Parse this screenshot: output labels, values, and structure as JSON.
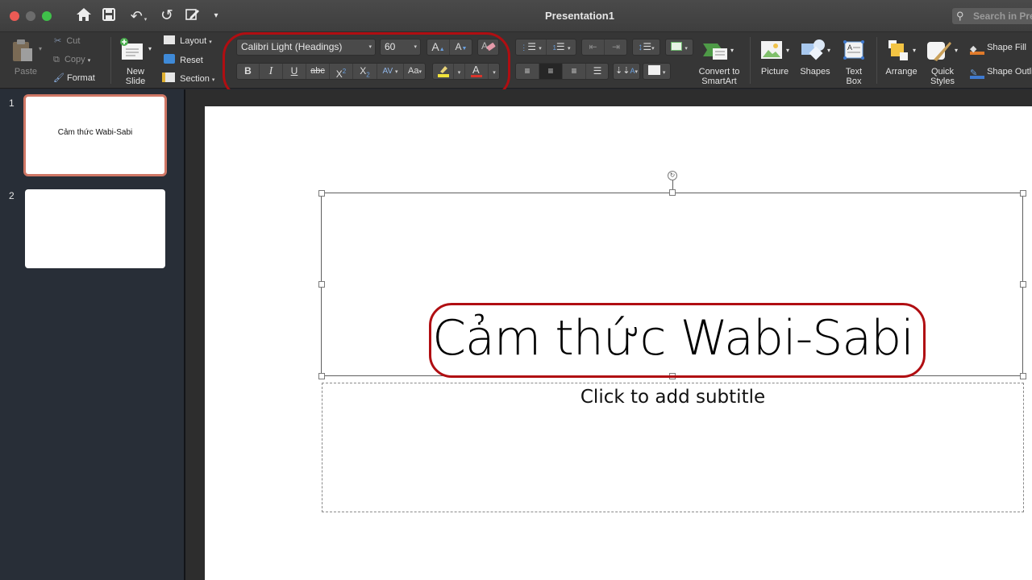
{
  "window": {
    "title": "Presentation1",
    "search_placeholder": "Search in Presentation",
    "traffic_colors": {
      "close": "#ec5b55",
      "minimize": "#6c6c6c",
      "zoom": "#3fc04a"
    }
  },
  "quick_access": [
    {
      "name": "home",
      "glyph": "⌂"
    },
    {
      "name": "save",
      "glyph": "💾"
    },
    {
      "name": "undo",
      "glyph": "↶"
    },
    {
      "name": "redo",
      "glyph": "↺"
    },
    {
      "name": "edit",
      "glyph": "✎"
    },
    {
      "name": "customize",
      "glyph": "▾"
    }
  ],
  "ribbon": {
    "clipboard": {
      "paste": "Paste",
      "cut": "Cut",
      "copy": "Copy",
      "format": "Format"
    },
    "slides": {
      "new_slide_line1": "New",
      "new_slide_line2": "Slide",
      "layout": "Layout",
      "reset": "Reset",
      "section": "Section"
    },
    "font": {
      "font_name": "Calibri Light (Headings)",
      "font_size": "60",
      "increase": "A▴",
      "decrease": "A▾",
      "bold": "B",
      "italic": "I",
      "underline": "U",
      "strikethrough": "abc",
      "superscript": "X²",
      "subscript": "X₂",
      "char_spacing": "AV",
      "change_case": "Aa",
      "highlight_color": "#f1e33a",
      "font_color": "#d9342b"
    },
    "paragraph": {
      "bullets": "☰",
      "numbering": "☰",
      "alignment_selected": "center"
    },
    "smartart": {
      "line1": "Convert to",
      "line2": "SmartArt"
    },
    "insert": {
      "picture": "Picture",
      "shapes": "Shapes",
      "textbox_line1": "Text",
      "textbox_line2": "Box"
    },
    "drawing": {
      "arrange": "Arrange",
      "quick_styles_line1": "Quick",
      "quick_styles_line2": "Styles",
      "shape_fill": "Shape Fill",
      "shape_outline": "Shape Outline"
    }
  },
  "thumbnails": [
    {
      "number": "1",
      "text": "Cảm thức Wabi-Sabi",
      "selected": true
    },
    {
      "number": "2",
      "text": "",
      "selected": false
    }
  ],
  "slide": {
    "title": "Cảm thức Wabi-Sabi",
    "subtitle_placeholder": "Click to add subtitle"
  },
  "annotations": {
    "highlight_color": "#b00e12"
  }
}
